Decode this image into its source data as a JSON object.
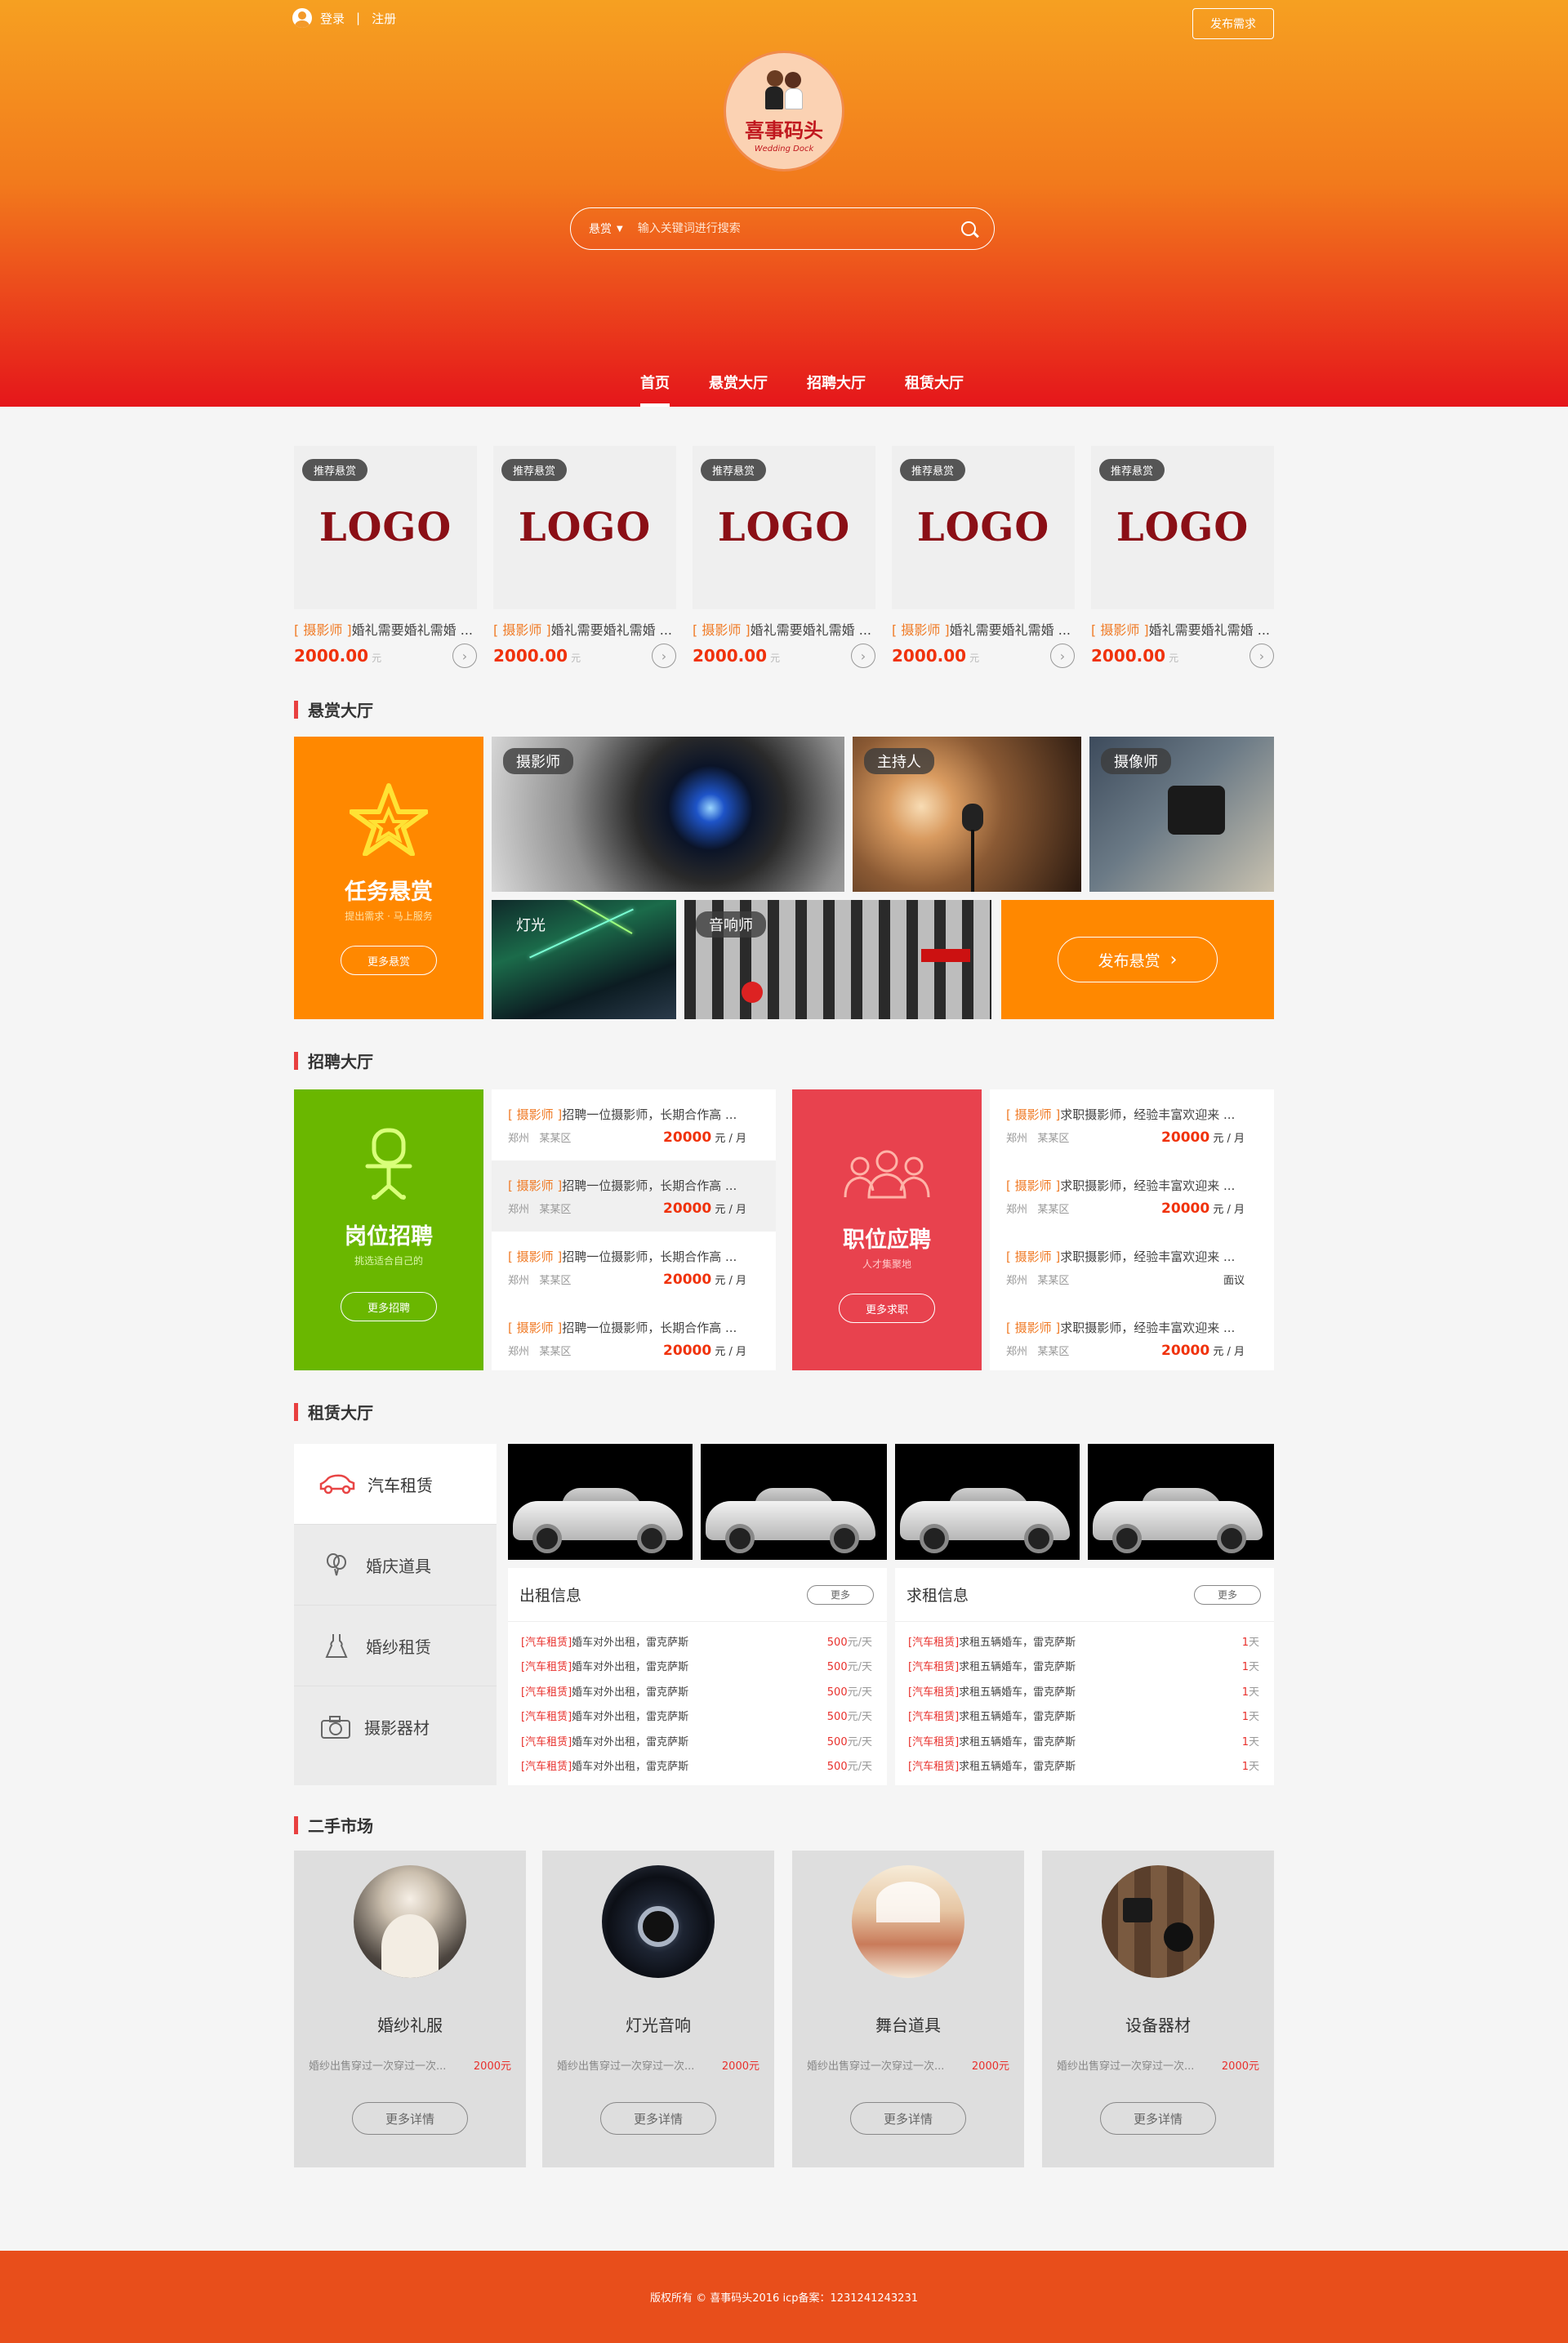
{
  "topbar": {
    "login": "登录",
    "divider": "|",
    "register": "注册",
    "publish": "发布需求"
  },
  "brand": {
    "name": "喜事码头",
    "tagline": "Wedding Dock"
  },
  "search": {
    "scope": "悬赏",
    "placeholder": "输入关键词进行搜索"
  },
  "nav": [
    "首页",
    "悬赏大厅",
    "招聘大厅",
    "租赁大厅"
  ],
  "recommended": [
    {
      "tag": "推荐悬赏",
      "logo": "LOGO",
      "category": "[ 摄影师 ]",
      "title": "婚礼需要婚礼需婚 ...",
      "price": "2000.00",
      "unit": "元"
    },
    {
      "tag": "推荐悬赏",
      "logo": "LOGO",
      "category": "[ 摄影师 ]",
      "title": "婚礼需要婚礼需婚 ...",
      "price": "2000.00",
      "unit": "元"
    },
    {
      "tag": "推荐悬赏",
      "logo": "LOGO",
      "category": "[ 摄影师 ]",
      "title": "婚礼需要婚礼需婚 ...",
      "price": "2000.00",
      "unit": "元"
    },
    {
      "tag": "推荐悬赏",
      "logo": "LOGO",
      "category": "[ 摄影师 ]",
      "title": "婚礼需要婚礼需婚 ...",
      "price": "2000.00",
      "unit": "元"
    },
    {
      "tag": "推荐悬赏",
      "logo": "LOGO",
      "category": "[ 摄影师 ]",
      "title": "婚礼需要婚礼需婚 ...",
      "price": "2000.00",
      "unit": "元"
    }
  ],
  "reward": {
    "title": "悬赏大厅",
    "promo": {
      "title": "任务悬赏",
      "sub": "提出需求 · 马上服务",
      "btn": "更多悬赏"
    },
    "tiles": [
      "摄影师",
      "主持人",
      "摄像师",
      "灯光",
      "音响师"
    ],
    "publish_btn": "发布悬赏"
  },
  "jobs": {
    "title": "招聘大厅",
    "hire": {
      "title": "岗位招聘",
      "sub": "挑选适合自己的",
      "btn": "更多招聘"
    },
    "seek": {
      "title": "职位应聘",
      "sub": "人才集聚地",
      "btn": "更多求职"
    },
    "hire_list": [
      {
        "cat": "[ 摄影师 ]",
        "text": "招聘一位摄影师，长期合作高 ...",
        "city": "郑州",
        "area": "某某区",
        "price": "20000",
        "unit": "元 / 月"
      },
      {
        "cat": "[ 摄影师 ]",
        "text": "招聘一位摄影师，长期合作高 ...",
        "city": "郑州",
        "area": "某某区",
        "price": "20000",
        "unit": "元 / 月"
      },
      {
        "cat": "[ 摄影师 ]",
        "text": "招聘一位摄影师，长期合作高 ...",
        "city": "郑州",
        "area": "某某区",
        "price": "20000",
        "unit": "元 / 月"
      },
      {
        "cat": "[ 摄影师 ]",
        "text": "招聘一位摄影师，长期合作高 ...",
        "city": "郑州",
        "area": "某某区",
        "price": "20000",
        "unit": "元 / 月"
      }
    ],
    "seek_list": [
      {
        "cat": "[ 摄影师 ]",
        "text": "求职摄影师，经验丰富欢迎来 ...",
        "city": "郑州",
        "area": "某某区",
        "price": "20000",
        "unit": "元 / 月"
      },
      {
        "cat": "[ 摄影师 ]",
        "text": "求职摄影师，经验丰富欢迎来 ...",
        "city": "郑州",
        "area": "某某区",
        "price": "20000",
        "unit": "元 / 月"
      },
      {
        "cat": "[ 摄影师 ]",
        "text": "求职摄影师，经验丰富欢迎来 ...",
        "city": "郑州",
        "area": "某某区",
        "price": "",
        "unit": "面议"
      },
      {
        "cat": "[ 摄影师 ]",
        "text": "求职摄影师，经验丰富欢迎来 ...",
        "city": "郑州",
        "area": "某某区",
        "price": "20000",
        "unit": "元 / 月"
      }
    ]
  },
  "rental": {
    "title": "租赁大厅",
    "sidebar": [
      {
        "icon": "car-icon",
        "label": "汽车租赁"
      },
      {
        "icon": "balloon-icon",
        "label": "婚庆道具"
      },
      {
        "icon": "dress-icon",
        "label": "婚纱租赁"
      },
      {
        "icon": "camera-icon",
        "label": "摄影器材"
      }
    ],
    "rent_out": {
      "title": "出租信息",
      "more": "更多",
      "rows": [
        {
          "cat": "[汽车租赁]",
          "text": "婚车对外出租，雷克萨斯",
          "price": "500",
          "unit": "元/天"
        },
        {
          "cat": "[汽车租赁]",
          "text": "婚车对外出租，雷克萨斯",
          "price": "500",
          "unit": "元/天"
        },
        {
          "cat": "[汽车租赁]",
          "text": "婚车对外出租，雷克萨斯",
          "price": "500",
          "unit": "元/天"
        },
        {
          "cat": "[汽车租赁]",
          "text": "婚车对外出租，雷克萨斯",
          "price": "500",
          "unit": "元/天"
        },
        {
          "cat": "[汽车租赁]",
          "text": "婚车对外出租，雷克萨斯",
          "price": "500",
          "unit": "元/天"
        },
        {
          "cat": "[汽车租赁]",
          "text": "婚车对外出租，雷克萨斯",
          "price": "500",
          "unit": "元/天"
        }
      ]
    },
    "rent_in": {
      "title": "求租信息",
      "more": "更多",
      "rows": [
        {
          "cat": "[汽车租赁]",
          "text": "求租五辆婚车，雷克萨斯",
          "price": "1",
          "unit": "天"
        },
        {
          "cat": "[汽车租赁]",
          "text": "求租五辆婚车，雷克萨斯",
          "price": "1",
          "unit": "天"
        },
        {
          "cat": "[汽车租赁]",
          "text": "求租五辆婚车，雷克萨斯",
          "price": "1",
          "unit": "天"
        },
        {
          "cat": "[汽车租赁]",
          "text": "求租五辆婚车，雷克萨斯",
          "price": "1",
          "unit": "天"
        },
        {
          "cat": "[汽车租赁]",
          "text": "求租五辆婚车，雷克萨斯",
          "price": "1",
          "unit": "天"
        },
        {
          "cat": "[汽车租赁]",
          "text": "求租五辆婚车，雷克萨斯",
          "price": "1",
          "unit": "天"
        }
      ]
    }
  },
  "second_hand": {
    "title": "二手市场",
    "items": [
      {
        "name": "婚纱礼服",
        "desc": "婚纱出售穿过一次穿过一次...",
        "price": "2000元",
        "btn": "更多详情"
      },
      {
        "name": "灯光音响",
        "desc": "婚纱出售穿过一次穿过一次...",
        "price": "2000元",
        "btn": "更多详情"
      },
      {
        "name": "舞台道具",
        "desc": "婚纱出售穿过一次穿过一次...",
        "price": "2000元",
        "btn": "更多详情"
      },
      {
        "name": "设备器材",
        "desc": "婚纱出售穿过一次穿过一次...",
        "price": "2000元",
        "btn": "更多详情"
      }
    ]
  },
  "footer": {
    "text": "版权所有 © 喜事码头2016    icp备案：1231241243231"
  },
  "colors": {
    "orange": "#ff8800",
    "green": "#6ab700",
    "red": "#e8424e",
    "footer": "#e84e1b"
  }
}
